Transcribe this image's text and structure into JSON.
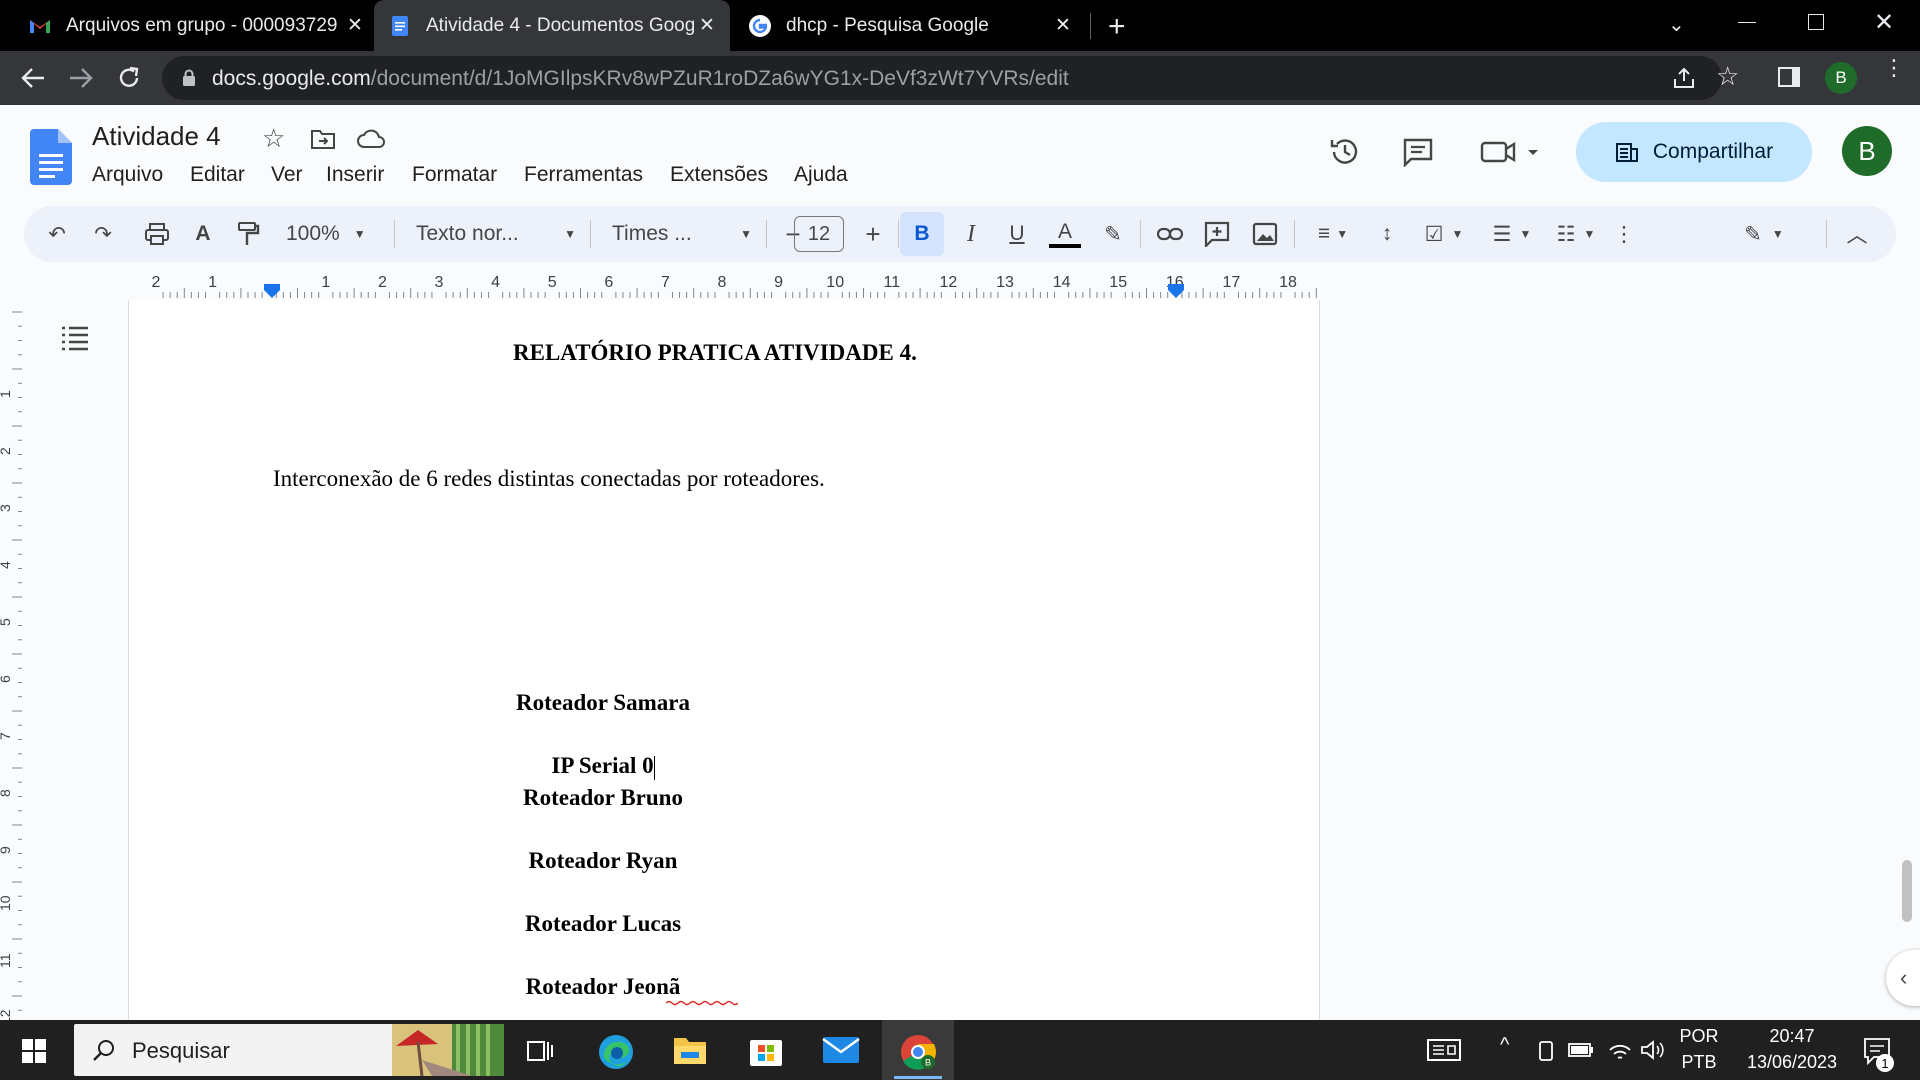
{
  "browser": {
    "tabs": [
      {
        "title": "Arquivos em grupo - 000093729",
        "icon": "gmail-icon",
        "active": false
      },
      {
        "title": "Atividade 4 - Documentos Googl",
        "icon": "docs-icon",
        "active": true
      },
      {
        "title": "dhcp - Pesquisa Google",
        "icon": "google-icon",
        "active": false
      }
    ],
    "url_host": "docs.google.com",
    "url_path": "/document/d/1JoMGIlpsKRv8wPZuR1roDZa6wYG1x-DeVf3zWt7YVRs/edit",
    "profile_initial": "B"
  },
  "docs": {
    "title": "Atividade 4",
    "menu": [
      "Arquivo",
      "Editar",
      "Ver",
      "Inserir",
      "Formatar",
      "Ferramentas",
      "Extensões",
      "Ajuda"
    ],
    "share_label": "Compartilhar",
    "account_initial": "B"
  },
  "format_toolbar": {
    "zoom": "100%",
    "style": "Texto nor...",
    "font": "Times ...",
    "font_size": "12",
    "bold_label": "B",
    "italic_label": "I",
    "underline_label": "U",
    "text_color_label": "A"
  },
  "ruler": {
    "labels": [
      "2",
      "1",
      "",
      "1",
      "2",
      "3",
      "4",
      "5",
      "6",
      "7",
      "8",
      "9",
      "10",
      "11",
      "12",
      "13",
      "14",
      "15",
      "16",
      "17",
      "18"
    ],
    "vertical_labels": [
      "1",
      "2",
      "3",
      "4",
      "5",
      "6",
      "7",
      "8",
      "9",
      "10",
      "11",
      "12"
    ]
  },
  "document": {
    "heading": "RELATÓRIO PRATICA ATIVIDADE 4.",
    "paragraph": "Interconexão de 6 redes distintas conectadas por roteadores.",
    "lines": [
      "Roteador Samara",
      "IP Serial 0",
      "Roteador Bruno",
      "Roteador Ryan",
      "Roteador Lucas",
      "Roteador Jeonã"
    ]
  },
  "taskbar": {
    "search_placeholder": "Pesquisar",
    "lang_top": "POR",
    "lang_bottom": "PTB",
    "time": "20:47",
    "date": "13/06/2023",
    "notification_count": "1"
  }
}
